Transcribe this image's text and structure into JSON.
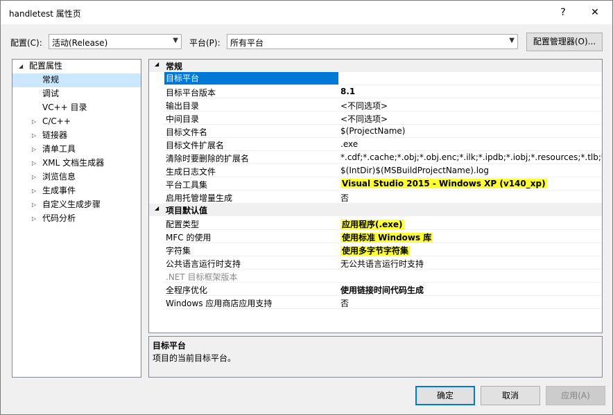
{
  "window": {
    "title": "handletest 属性页",
    "help_label": "?",
    "close_label": "✕"
  },
  "config_bar": {
    "config_label": "配置(C):",
    "config_value": "活动(Release)",
    "platform_label": "平台(P):",
    "platform_value": "所有平台",
    "manager_button": "配置管理器(O)..."
  },
  "tree": {
    "items": [
      {
        "label": "配置属性",
        "expander": "◢"
      },
      {
        "label": "常规",
        "expander": ""
      },
      {
        "label": "调试",
        "expander": ""
      },
      {
        "label": "VC++ 目录",
        "expander": ""
      },
      {
        "label": "C/C++",
        "expander": "▷"
      },
      {
        "label": "链接器",
        "expander": "▷"
      },
      {
        "label": "清单工具",
        "expander": "▷"
      },
      {
        "label": "XML 文档生成器",
        "expander": "▷"
      },
      {
        "label": "浏览信息",
        "expander": "▷"
      },
      {
        "label": "生成事件",
        "expander": "▷"
      },
      {
        "label": "自定义生成步骤",
        "expander": "▷"
      },
      {
        "label": "代码分析",
        "expander": "▷"
      }
    ]
  },
  "grid": {
    "categories": [
      {
        "label": "常规",
        "expander": "◢"
      },
      {
        "label": "项目默认值",
        "expander": "◢"
      }
    ],
    "general": [
      {
        "name": "目标平台",
        "value": ""
      },
      {
        "name": "目标平台版本",
        "value": "8.1"
      },
      {
        "name": "输出目录",
        "value": "<不同选项>"
      },
      {
        "name": "中间目录",
        "value": "<不同选项>"
      },
      {
        "name": "目标文件名",
        "value": "$(ProjectName)"
      },
      {
        "name": "目标文件扩展名",
        "value": ".exe"
      },
      {
        "name": "清除时要删除的扩展名",
        "value": "*.cdf;*.cache;*.obj;*.obj.enc;*.ilk;*.ipdb;*.iobj;*.resources;*.tlb;*.tli;*.t"
      },
      {
        "name": "生成日志文件",
        "value": "$(IntDir)$(MSBuildProjectName).log"
      },
      {
        "name": "平台工具集",
        "value": "Visual Studio 2015 - Windows XP (v140_xp)"
      },
      {
        "name": "启用托管增量生成",
        "value": "否"
      }
    ],
    "defaults": [
      {
        "name": "配置类型",
        "value": "应用程序(.exe)"
      },
      {
        "name": "MFC 的使用",
        "value": "使用标准 Windows 库"
      },
      {
        "name": "字符集",
        "value": "使用多字节字符集"
      },
      {
        "name": "公共语言运行时支持",
        "value": "无公共语言运行时支持"
      },
      {
        "name": ".NET 目标框架版本",
        "value": ""
      },
      {
        "name": "全程序优化",
        "value": "使用链接时间代码生成"
      },
      {
        "name": "Windows 应用商店应用支持",
        "value": "否"
      }
    ]
  },
  "description": {
    "title": "目标平台",
    "text": "项目的当前目标平台。"
  },
  "buttons": {
    "ok": "确定",
    "cancel": "取消",
    "apply": "应用(A)"
  },
  "colors": {
    "selection": "#0078d7",
    "highlight": "#ffff33",
    "tree_selection": "#cce8ff"
  }
}
